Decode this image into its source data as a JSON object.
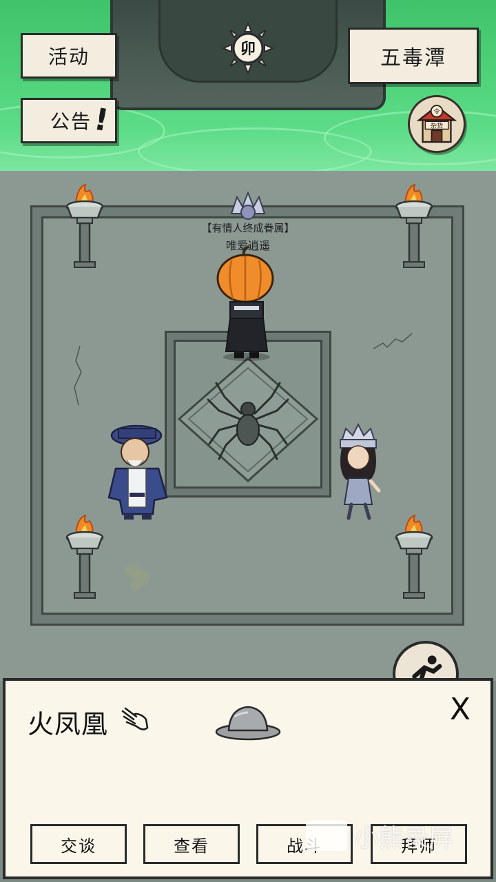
{
  "top_buttons": {
    "activity_label": "活动",
    "notice_label": "公告",
    "notice_alert": "!"
  },
  "location": {
    "name": "五毒潭"
  },
  "clock": {
    "hour_glyph": "卯"
  },
  "shop": {
    "sign_top": "令",
    "sign_label": "杂货"
  },
  "player": {
    "title": "【有情人终成眷属】",
    "name": "唯爱逍遥"
  },
  "dialog": {
    "npc_name": "火凤凰",
    "close_symbol": "X",
    "actions": [
      "交谈",
      "查看",
      "战斗",
      "拜师"
    ]
  },
  "watermark": {
    "text": "小熊录屏"
  },
  "colors": {
    "poison_pool": "#4fd27a",
    "stone_floor": "#8c9993",
    "paper": "#f3ede0",
    "flame": "#f08a24"
  },
  "icons": [
    "clock-sun-icon",
    "shop-icon",
    "hand-pointer-icon",
    "hat-icon",
    "close-icon",
    "sprint-icon",
    "spider-emblem-icon",
    "brazier-icon"
  ]
}
